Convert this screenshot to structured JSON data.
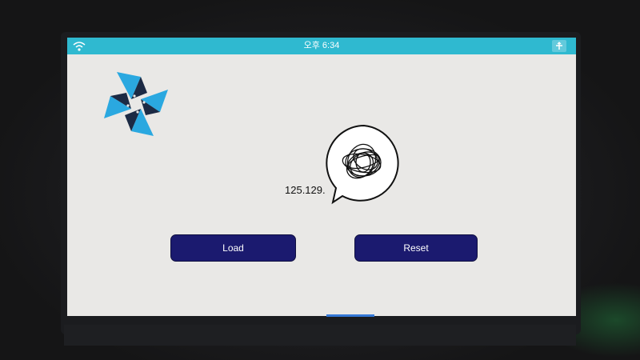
{
  "statusbar": {
    "time": "오후 6:34",
    "left_icon": "wifi-icon",
    "right_icon": "network-icon",
    "color": "#2fb9d0"
  },
  "app": {
    "logo_icon": "tizen-pinwheel-logo",
    "ip_text": "125.129.",
    "load_label": "Load",
    "reset_label": "Reset",
    "button_color": "#1b1a6f"
  }
}
